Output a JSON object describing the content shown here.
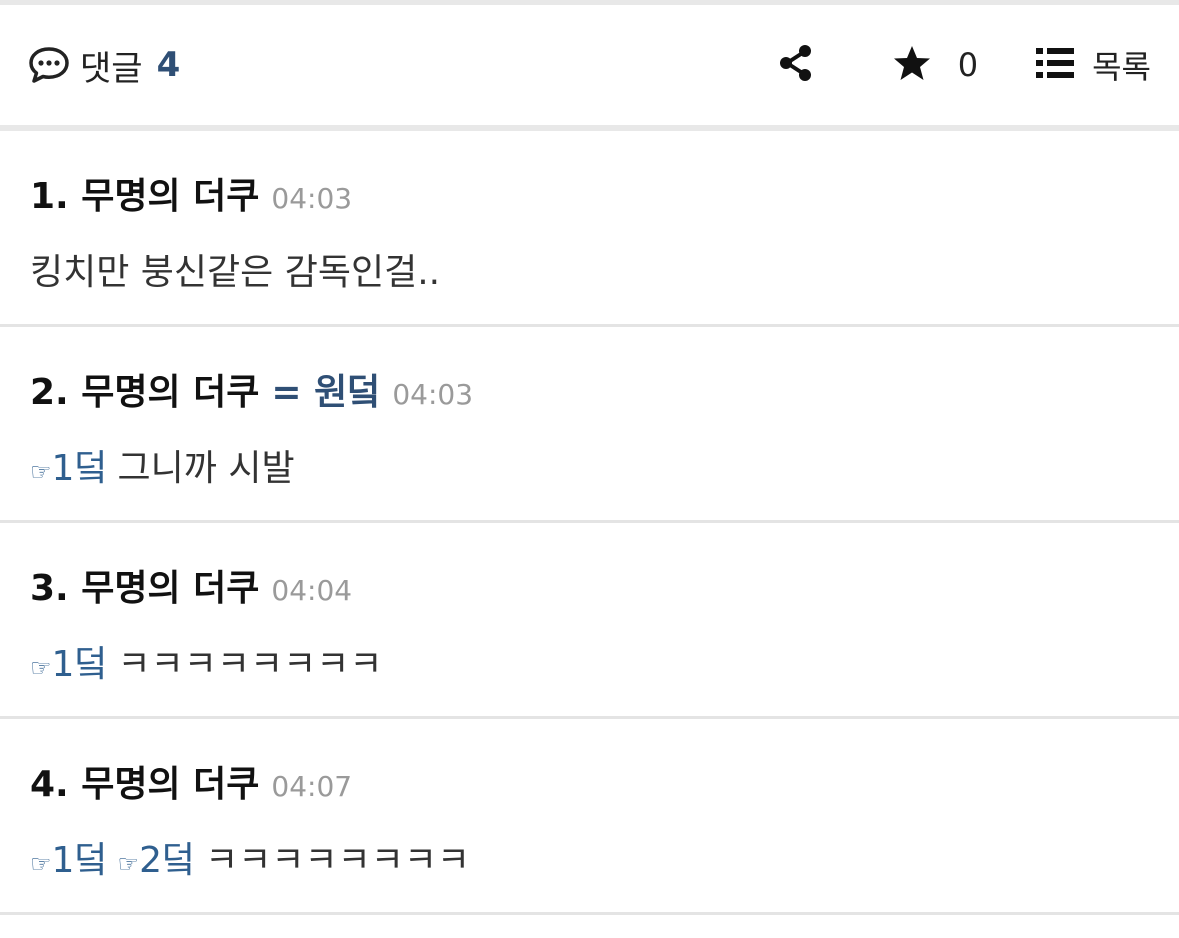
{
  "header": {
    "comment_label": "댓글",
    "comment_count": "4",
    "star_count": "0",
    "list_label": "목록",
    "icons": [
      "comment-icon",
      "share-icon",
      "star-icon",
      "list-icon"
    ]
  },
  "colors": {
    "accent": "#2f4f75",
    "link": "#2f5f8f",
    "time": "#9a9a9a",
    "divider": "#e4e4e4"
  },
  "comments": [
    {
      "number": "1.",
      "author": "무명의 더쿠",
      "tag": "",
      "time": "04:03",
      "refs": [],
      "text": "킹치만 붕신같은 감독인걸.."
    },
    {
      "number": "2.",
      "author": "무명의 더쿠",
      "tag": "= 원덬",
      "time": "04:03",
      "refs": [
        {
          "hand": "☞",
          "label": "1덬"
        }
      ],
      "text": "그니까 시발"
    },
    {
      "number": "3.",
      "author": "무명의 더쿠",
      "tag": "",
      "time": "04:04",
      "refs": [
        {
          "hand": "☞",
          "label": "1덬"
        }
      ],
      "text": "ㅋㅋㅋㅋㅋㅋㅋㅋ"
    },
    {
      "number": "4.",
      "author": "무명의 더쿠",
      "tag": "",
      "time": "04:07",
      "refs": [
        {
          "hand": "☞",
          "label": "1덬"
        },
        {
          "hand": "☞",
          "label": "2덬"
        }
      ],
      "text": "ㅋㅋㅋㅋㅋㅋㅋㅋ"
    }
  ]
}
